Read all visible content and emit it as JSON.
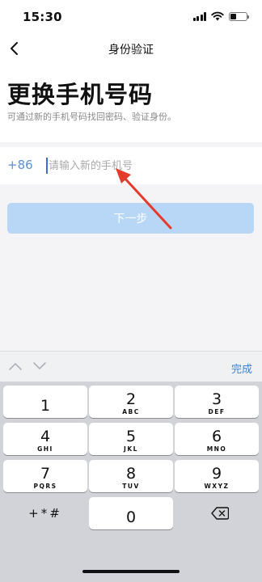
{
  "status_bar": {
    "time": "15:30"
  },
  "nav": {
    "title": "身份验证",
    "back_icon": "chevron-left-icon"
  },
  "page": {
    "title": "更换手机号码",
    "subtitle": "可通过新的手机号码找回密码、验证身份。"
  },
  "phone": {
    "country_code": "+86",
    "placeholder": "请输入新的手机号",
    "value": ""
  },
  "next_button": {
    "label": "下一步"
  },
  "keyboard_toolbar": {
    "done_label": "完成"
  },
  "keypad": {
    "keys": [
      {
        "num": "1",
        "letters": ""
      },
      {
        "num": "2",
        "letters": "ABC"
      },
      {
        "num": "3",
        "letters": "DEF"
      },
      {
        "num": "4",
        "letters": "GHI"
      },
      {
        "num": "5",
        "letters": "JKL"
      },
      {
        "num": "6",
        "letters": "MNO"
      },
      {
        "num": "7",
        "letters": "PQRS"
      },
      {
        "num": "8",
        "letters": "TUV"
      },
      {
        "num": "9",
        "letters": "WXYZ"
      },
      {
        "num": "0",
        "letters": ""
      }
    ],
    "symbols_label": "+*#"
  },
  "colors": {
    "accent": "#3a82d6",
    "button_disabled": "#b8d6f5",
    "annotation_arrow": "#e53b2c"
  }
}
